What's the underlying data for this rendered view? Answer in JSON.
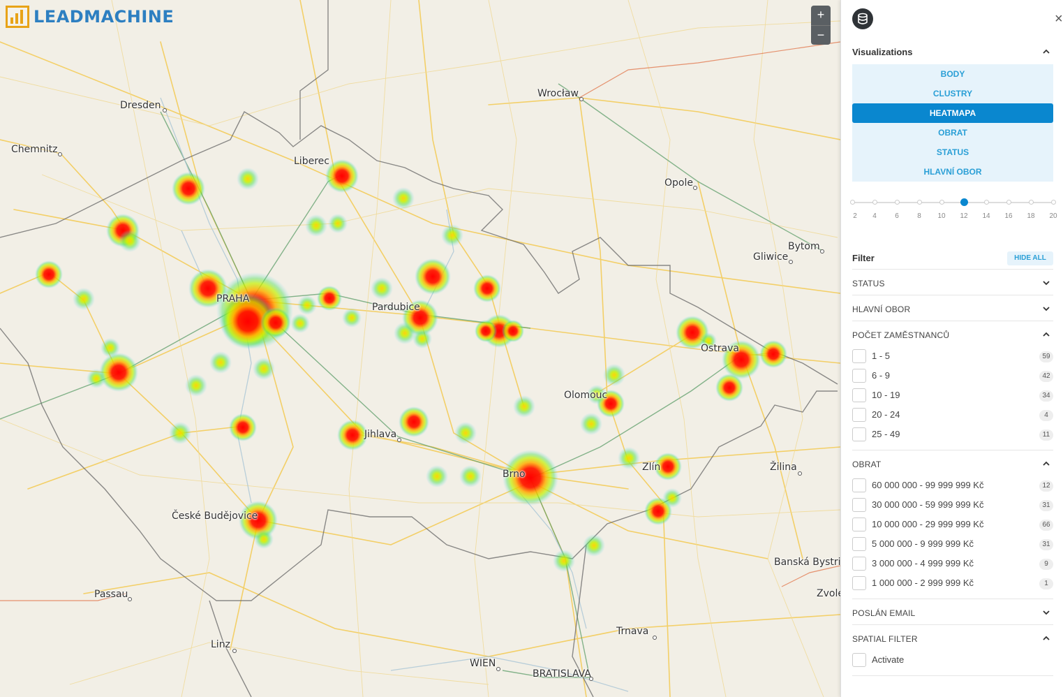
{
  "app": {
    "logo_text": "LEADMACHINE"
  },
  "map": {
    "zoom_in": "+",
    "zoom_out": "−",
    "cities": [
      "Dresden",
      "Chemnitz",
      "Liberec",
      "Wrocław",
      "Opole",
      "Bytom",
      "Gliwice",
      "PRAHA",
      "Pardubice",
      "Ostrava",
      "Olomouc",
      "Jihlava",
      "Brno",
      "Zlín",
      "Žilina",
      "České Budějovice",
      "Passau",
      "Linz",
      "WIEN",
      "BRATISLAVA",
      "Trnava",
      "Banská Bystrica",
      "Zvolen"
    ]
  },
  "panel": {
    "close_label": "×",
    "visualizations": {
      "title": "Visualizations",
      "items": [
        "BODY",
        "CLUSTRY",
        "HEATMAPA",
        "OBRAT",
        "STATUS",
        "HLAVNÍ OBOR"
      ],
      "active": "HEATMAPA"
    },
    "slider": {
      "ticks": [
        "2",
        "4",
        "6",
        "8",
        "10",
        "12",
        "14",
        "16",
        "18",
        "20"
      ],
      "value": 12
    },
    "filter": {
      "title": "Filter",
      "hide_all": "HIDE ALL",
      "status": "STATUS",
      "hlavni_obor": "HLAVNÍ OBOR",
      "pocet": {
        "title": "POČET ZAMĚSTNANCŮ",
        "options": [
          {
            "label": "1 - 5",
            "count": "59"
          },
          {
            "label": "6 - 9",
            "count": "42"
          },
          {
            "label": "10 - 19",
            "count": "34"
          },
          {
            "label": "20 - 24",
            "count": "4"
          },
          {
            "label": "25 - 49",
            "count": "11"
          }
        ]
      },
      "obrat": {
        "title": "OBRAT",
        "options": [
          {
            "label": "60 000 000 - 99 999 999 Kč",
            "count": "12"
          },
          {
            "label": "30 000 000 - 59 999 999 Kč",
            "count": "31"
          },
          {
            "label": "10 000 000 - 29 999 999 Kč",
            "count": "66"
          },
          {
            "label": "5 000 000 - 9 999 999 Kč",
            "count": "31"
          },
          {
            "label": "3 000 000 - 4 999 999 Kč",
            "count": "9"
          },
          {
            "label": "1 000 000 - 2 999 999 Kč",
            "count": "1"
          }
        ]
      },
      "poslan_email": "POSLÁN EMAIL",
      "spatial": {
        "title": "SPATIAL FILTER",
        "activate": "Activate"
      }
    }
  },
  "colors": {
    "accent": "#0a87cf",
    "accent_light": "#e6f3fb",
    "logo_blue": "#2d7fc1",
    "logo_gold": "#e8a317"
  }
}
